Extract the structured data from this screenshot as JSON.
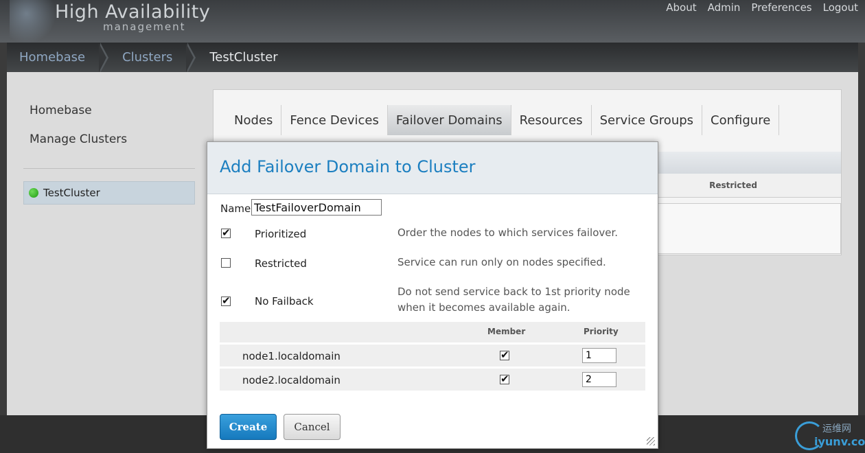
{
  "header": {
    "logo_main": "High Availability",
    "logo_sub": "management",
    "links": [
      "About",
      "Admin",
      "Preferences",
      "Logout"
    ]
  },
  "breadcrumb": [
    "Homebase",
    "Clusters",
    "TestCluster"
  ],
  "sidebar": {
    "items": [
      "Homebase",
      "Manage Clusters"
    ],
    "cluster": "TestCluster"
  },
  "tabs": [
    "Nodes",
    "Fence Devices",
    "Failover Domains",
    "Resources",
    "Service Groups",
    "Configure"
  ],
  "content": {
    "restricted_header": "Restricted"
  },
  "modal": {
    "title": "Add Failover Domain to Cluster",
    "name_label": "Name",
    "name_value": "TestFailoverDomain",
    "options": [
      {
        "label": "Prioritized",
        "checked": true,
        "desc": "Order the nodes to which services failover."
      },
      {
        "label": "Restricted",
        "checked": false,
        "desc": "Service can run only on nodes specified."
      },
      {
        "label": "No Failback",
        "checked": true,
        "desc_line1": "Do not send service back to 1st priority node",
        "desc_line2": "when it becomes available again."
      }
    ],
    "table": {
      "member_header": "Member",
      "priority_header": "Priority",
      "rows": [
        {
          "node": "node1.localdomain",
          "member": true,
          "priority": "1"
        },
        {
          "node": "node2.localdomain",
          "member": true,
          "priority": "2"
        }
      ]
    },
    "create_label": "Create",
    "cancel_label": "Cancel"
  },
  "watermark": {
    "cn": "运维网",
    "en": "iyunv.com"
  },
  "colors": {
    "accent": "#1c7fc0",
    "status_online": "#2fb81e"
  }
}
